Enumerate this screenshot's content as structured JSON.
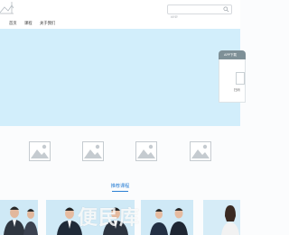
{
  "header": {
    "search_placeholder": "搜索"
  },
  "nav": {
    "items": [
      {
        "label": "首页"
      },
      {
        "label": "课程"
      },
      {
        "label": "关于我们"
      }
    ]
  },
  "banner": {
    "slide_count": 2,
    "active_slide": 1
  },
  "app_panel": {
    "title": "APP下载",
    "hint": "扫码"
  },
  "recommend": {
    "title": "推荐课程"
  },
  "watermark": "便民库",
  "colors": {
    "accent": "#2a7fd4",
    "banner_bg": "#d2eefb",
    "card_bg": "#cfe9f6"
  }
}
